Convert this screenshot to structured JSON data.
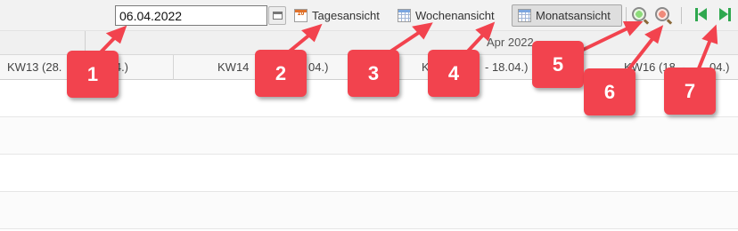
{
  "toolbar": {
    "date_value": "06.04.2022",
    "day_view_label": "Tagesansicht",
    "day_view_icon_text": "10",
    "week_view_label": "Wochenansicht",
    "month_view_label": "Monatsansicht",
    "selected_view": "Monatsansicht",
    "icons": [
      "calendar-picker-icon",
      "day-calendar-icon",
      "week-calendar-icon",
      "month-calendar-icon",
      "zoom-in-icon",
      "zoom-out-icon",
      "first-page-icon",
      "last-page-icon"
    ]
  },
  "timeline": {
    "month_label": "Apr 2022",
    "weeks": [
      "KW13 (28.03. - 03.04.)",
      "KW14 (04.04. - 10.04.)",
      "KW15 (11.04. - 18.04.)",
      "KW16 (18. - 24.04.)"
    ],
    "week_visible_texts": [
      "KW13 (28.",
      ".04.)",
      "KW14",
      "04.)",
      "K",
      "- 18.04.)",
      "KW16 (18. -",
      "04.)"
    ]
  },
  "annotations": [
    "1",
    "2",
    "3",
    "4",
    "5",
    "6",
    "7"
  ],
  "colors": {
    "callout": "#f2434e",
    "nav_green": "#2fa84f"
  }
}
